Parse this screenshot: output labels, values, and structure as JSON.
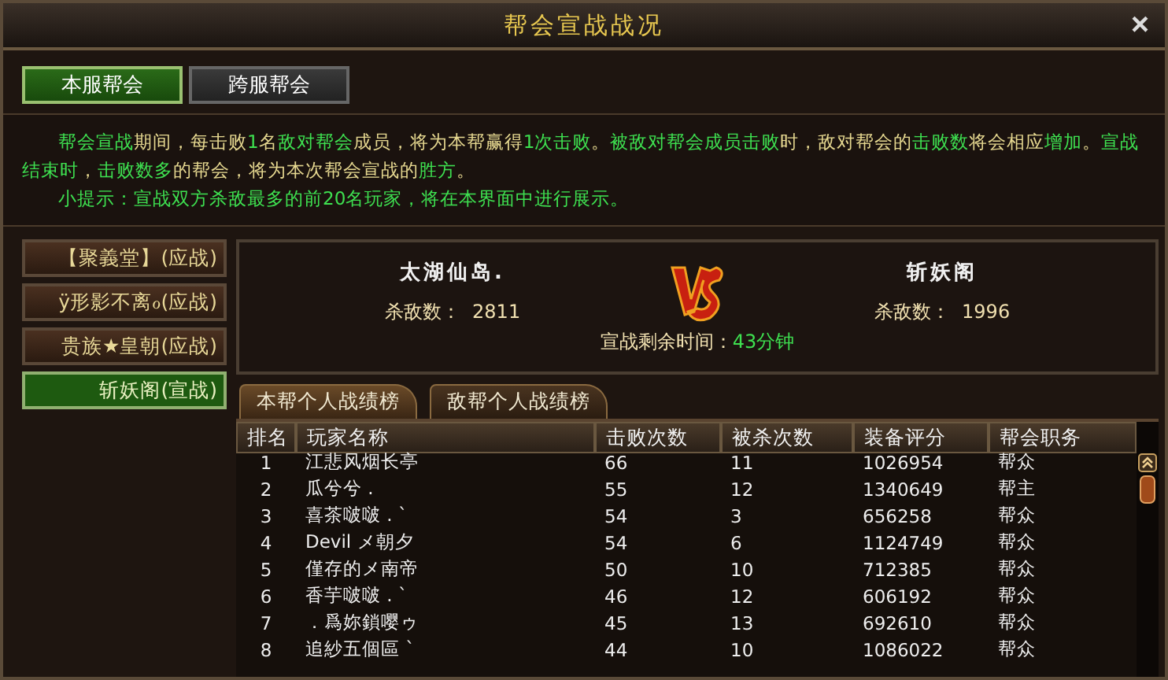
{
  "window": {
    "title": "帮会宣战战况",
    "close": "×"
  },
  "tabs": [
    {
      "label": "本服帮会",
      "selected": true
    },
    {
      "label": "跨服帮会",
      "selected": false
    }
  ],
  "intro": [
    [
      {
        "text": "帮会宣战",
        "highlight": true
      },
      {
        "text": "期间，每击败",
        "highlight": false
      },
      {
        "text": "1",
        "highlight": true
      },
      {
        "text": "名",
        "highlight": false
      },
      {
        "text": "敌对帮会",
        "highlight": true
      },
      {
        "text": "成员，将为本帮赢得",
        "highlight": false
      },
      {
        "text": "1次击败",
        "highlight": true
      },
      {
        "text": "。",
        "highlight": false
      },
      {
        "text": "被敌对帮会成员",
        "highlight": true
      },
      {
        "text": "击败",
        "highlight": true
      },
      {
        "text": "时，敌对帮会的",
        "highlight": false
      },
      {
        "text": "击败数",
        "highlight": true
      },
      {
        "text": "将会相应",
        "highlight": false
      },
      {
        "text": "增加",
        "highlight": true
      },
      {
        "text": "。",
        "highlight": false
      },
      {
        "text": "宣战结束时",
        "highlight": true
      },
      {
        "text": "，",
        "highlight": false
      },
      {
        "text": "击败数多",
        "highlight": true
      },
      {
        "text": "的帮会，将为本次帮会宣战的",
        "highlight": false
      },
      {
        "text": "胜方",
        "highlight": true
      },
      {
        "text": "。",
        "highlight": false
      }
    ],
    [
      {
        "text": "小提示：宣战双方杀敌最多的前20名玩家，将在本界面中进行展示。",
        "highlight": true
      }
    ]
  ],
  "guilds": [
    {
      "label": "【聚義堂】(应战)",
      "selected": false
    },
    {
      "label": "ÿ形影不离ℴ(应战)",
      "selected": false
    },
    {
      "label": "贵族★皇朝(应战)",
      "selected": false
    },
    {
      "label": "斩妖阁(宣战)",
      "selected": true
    }
  ],
  "battle": {
    "left": {
      "name": "太湖仙岛.",
      "kills_label": "杀敌数：",
      "kills": "2811"
    },
    "right": {
      "name": "斩妖阁",
      "kills_label": "杀敌数：",
      "kills": "1996"
    },
    "time_label": "宣战剩余时间：",
    "time": "43分钟"
  },
  "rank_tabs": [
    {
      "label": "本帮个人战绩榜",
      "selected": true
    },
    {
      "label": "敌帮个人战绩榜",
      "selected": false
    }
  ],
  "table": {
    "columns": [
      "排名",
      "玩家名称",
      "击败次数",
      "被杀次数",
      "装备评分",
      "帮会职务"
    ],
    "rows": [
      [
        "1",
        "江悲风烟长亭",
        "66",
        "11",
        "1026954",
        "帮众"
      ],
      [
        "2",
        "瓜兮兮 .",
        "55",
        "12",
        "1340649",
        "帮主"
      ],
      [
        "3",
        "喜茶啵啵 . `",
        "54",
        "3",
        "656258",
        "帮众"
      ],
      [
        "4",
        "Devil メ朝夕",
        "54",
        "6",
        "1124749",
        "帮众"
      ],
      [
        "5",
        "僅存的メ南帝",
        "50",
        "10",
        "712385",
        "帮众"
      ],
      [
        "6",
        "香芋啵啵 . `",
        "46",
        "12",
        "606192",
        "帮众"
      ],
      [
        "7",
        "．爲妳鎖嘤ゥ",
        "45",
        "13",
        "692610",
        "帮众"
      ],
      [
        "8",
        "追紗五個區 `",
        "44",
        "10",
        "1086022",
        "帮众"
      ]
    ]
  }
}
